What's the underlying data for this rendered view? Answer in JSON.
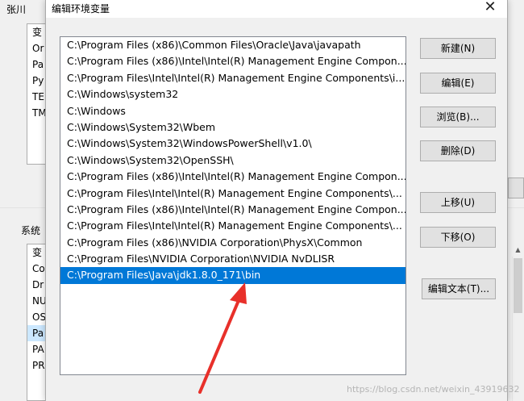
{
  "background_window": {
    "user_vars_label": "张川",
    "user_list_rows": [
      "变",
      "Or",
      "Pa",
      "Py",
      "TE",
      "TM"
    ],
    "system_vars_label": "系统",
    "system_list_rows": [
      "变",
      "Co",
      "Dr",
      "NU",
      "OS",
      "Pa",
      "PA",
      "PR"
    ]
  },
  "dialog": {
    "title": "编辑环境变量",
    "close_symbol": "✕",
    "paths": [
      "C:\\Program Files (x86)\\Common Files\\Oracle\\Java\\javapath",
      "C:\\Program Files (x86)\\Intel\\Intel(R) Management Engine Compon...",
      "C:\\Program Files\\Intel\\Intel(R) Management Engine Components\\i...",
      "C:\\Windows\\system32",
      "C:\\Windows",
      "C:\\Windows\\System32\\Wbem",
      "C:\\Windows\\System32\\WindowsPowerShell\\v1.0\\",
      "C:\\Windows\\System32\\OpenSSH\\",
      "C:\\Program Files (x86)\\Intel\\Intel(R) Management Engine Compon...",
      "C:\\Program Files\\Intel\\Intel(R) Management Engine Components\\...",
      "C:\\Program Files (x86)\\Intel\\Intel(R) Management Engine Compon...",
      "C:\\Program Files\\Intel\\Intel(R) Management Engine Components\\...",
      "C:\\Program Files (x86)\\NVIDIA Corporation\\PhysX\\Common",
      "C:\\Program Files\\NVIDIA Corporation\\NVIDIA NvDLISR",
      "C:\\Program Files\\Java\\jdk1.8.0_171\\bin"
    ],
    "selected_index": 14,
    "buttons": {
      "new": "新建(N)",
      "edit": "编辑(E)",
      "browse": "浏览(B)...",
      "delete": "删除(D)",
      "move_up": "上移(U)",
      "move_down": "下移(O)",
      "edit_text": "编辑文本(T)..."
    }
  },
  "annotation": {
    "arrow_color": "#e8302a"
  },
  "watermark": "https://blog.csdn.net/weixin_43919632"
}
